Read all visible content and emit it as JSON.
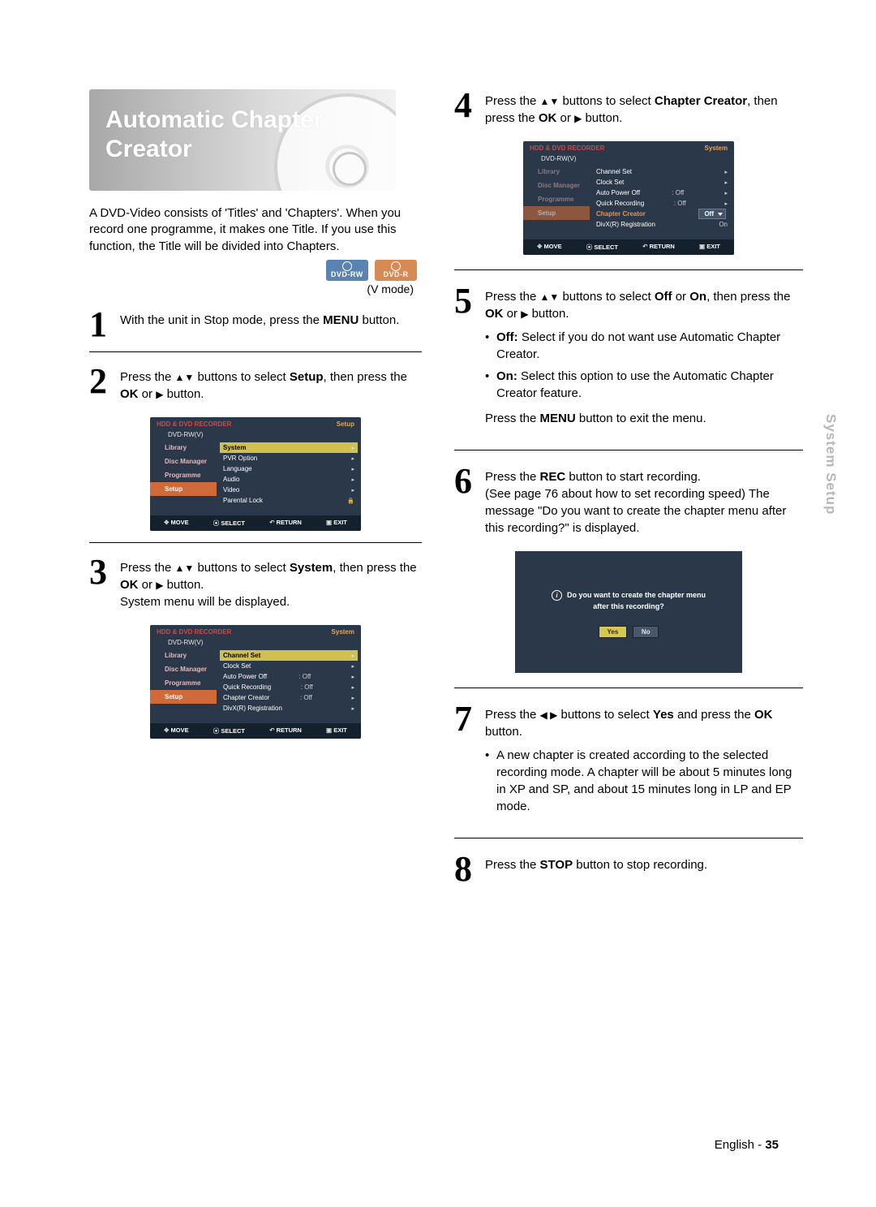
{
  "hero": {
    "title": "Automatic Chapter Creator"
  },
  "intro": "A DVD-Video consists of 'Titles' and 'Chapters'. When you record one programme, it makes one Title. If you use this function, the Title will be divided into Chapters.",
  "badges": {
    "rw": "DVD-RW",
    "r": "DVD-R"
  },
  "vmode": "(V mode)",
  "steps": {
    "s1": {
      "n": "1",
      "a": "With the unit in Stop mode, press the ",
      "b": "MENU",
      "c": " button."
    },
    "s2": {
      "n": "2",
      "a": "Press the ",
      "arrows": "▲▼",
      "b": " buttons to select ",
      "c": "Setup",
      "d": ", then press the ",
      "e": "OK",
      "f": " or ",
      "g": "▶",
      "h": " button."
    },
    "s3": {
      "n": "3",
      "a": "Press the ",
      "arrows": "▲▼",
      "b": " buttons to select ",
      "c": "System",
      "d": ", then press the ",
      "e": "OK",
      "f": " or ",
      "g": "▶",
      "h": " button.",
      "tail": "System menu will be displayed."
    },
    "s4": {
      "n": "4",
      "a": "Press the  ",
      "arrows": "▲▼",
      "b": " buttons to select ",
      "c": "Chapter Creator",
      "d": ", then press the ",
      "e": "OK",
      "f": " or ",
      "g": "▶",
      "h": " button."
    },
    "s5": {
      "n": "5",
      "a": "Press the ",
      "arrows": "▲▼",
      "b": " buttons to select ",
      "c": "Off",
      "d": " or ",
      "e": "On",
      "f": ", then press the ",
      "g": "OK",
      "h": " or ",
      "i": "▶",
      "j": " button."
    },
    "s5_bullets": {
      "off_l": "Off:",
      "off_t": " Select if you do not want use Automatic Chapter Creator.",
      "on_l": "On:",
      "on_t": " Select this option to use the Automatic Chapter Creator feature."
    },
    "s5_note": {
      "a": "Press the ",
      "b": "MENU",
      "c": " button to exit the menu."
    },
    "s6": {
      "n": "6",
      "a": "Press the ",
      "b": "REC",
      "c": " button to start recording.",
      "d": "(See page 76 about how to set recording speed) The message \"Do you want to create the chapter menu after this recording?\" is displayed."
    },
    "s7": {
      "n": "7",
      "a": "Press the ",
      "arrows": "◀ ▶",
      "b": " buttons to select ",
      "c": "Yes",
      "d": " and press the ",
      "e": "OK",
      "f": " button.",
      "bullet": "A new chapter is created according to the selected recording mode. A chapter will be about 5 minutes long in XP and SP, and about 15 minutes long in LP and EP mode."
    },
    "s8": {
      "n": "8",
      "a": "Press the ",
      "b": "STOP",
      "c": " button to stop recording."
    }
  },
  "osd": {
    "title_l": "HDD & DVD RECORDER",
    "sub": "DVD-RW(V)",
    "side": [
      "Library",
      "Disc Manager",
      "Programme",
      "Setup"
    ],
    "foot": {
      "move": "MOVE",
      "select": "SELECT",
      "return": "RETURN",
      "exit": "EXIT"
    },
    "setup_screen": {
      "title_r": "Setup",
      "items": [
        "System",
        "PVR Option",
        "Language",
        "Audio",
        "Video",
        "Parental Lock"
      ]
    },
    "system_screen": {
      "title_r": "System",
      "rows": [
        {
          "label": "Channel Set",
          "val": ""
        },
        {
          "label": "Clock Set",
          "val": ""
        },
        {
          "label": "Auto Power Off",
          "val": ": Off"
        },
        {
          "label": "Quick Recording",
          "val": ": Off"
        },
        {
          "label": "Chapter Creator",
          "val": ": Off"
        },
        {
          "label": "DivX(R) Registration",
          "val": ""
        }
      ]
    },
    "chapter_screen": {
      "title_r": "System",
      "rows": [
        {
          "label": "Channel Set",
          "val": ""
        },
        {
          "label": "Clock Set",
          "val": ""
        },
        {
          "label": "Auto Power Off",
          "val": ": Off"
        },
        {
          "label": "Quick Recording",
          "val": ": Off"
        },
        {
          "label": "Chapter Creator",
          "val": "Off",
          "hl": true,
          "dd": "Off"
        },
        {
          "label": "DivX(R) Registration",
          "val": "On"
        }
      ]
    },
    "dialog": {
      "line1": "Do you want to create the chapter menu",
      "line2": "after this recording?",
      "yes": "Yes",
      "no": "No"
    }
  },
  "side_tab": "System Setup",
  "footer": {
    "lang": "English",
    "dash": " - ",
    "page": "35"
  }
}
